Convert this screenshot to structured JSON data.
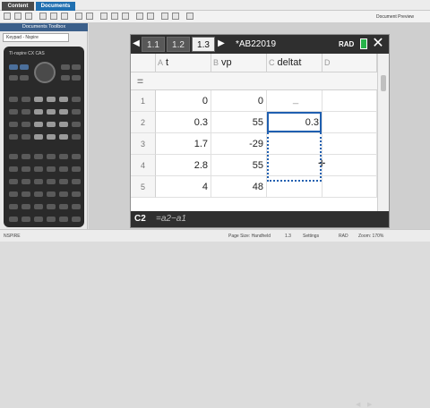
{
  "top_tabs": {
    "content": "Content",
    "documents": "Documents"
  },
  "toolbar": {
    "doc_preview": "Document Preview"
  },
  "left_panel": {
    "header": "Documents Toolbox",
    "keypad_select": "Keypad - Nspire",
    "calc_brand": "TI-nspire CX CAS"
  },
  "doc": {
    "tabs": [
      "1.1",
      "1.2",
      "1.3"
    ],
    "active_tab_index": 2,
    "title": "*AB22019",
    "mode": "RAD",
    "close": "✕",
    "prev_arrow": "◀",
    "next_arrow": "▶"
  },
  "sheet": {
    "columns": [
      {
        "letter": "A",
        "name": "t"
      },
      {
        "letter": "B",
        "name": "vp"
      },
      {
        "letter": "C",
        "name": "deltat"
      },
      {
        "letter": "D",
        "name": ""
      }
    ],
    "formula_row_symbol": "=",
    "rows": [
      {
        "num": "1",
        "t": "0",
        "vp": "0",
        "deltat": ""
      },
      {
        "num": "2",
        "t": "0.3",
        "vp": "55",
        "deltat": "0.3"
      },
      {
        "num": "3",
        "t": "1.7",
        "vp": "-29",
        "deltat": ""
      },
      {
        "num": "4",
        "t": "2.8",
        "vp": "55",
        "deltat": ""
      },
      {
        "num": "5",
        "t": "4",
        "vp": "48",
        "deltat": ""
      }
    ],
    "row1_tail": "_"
  },
  "entry_line": {
    "cell_ref": "C2",
    "formula": "=a2−a1"
  },
  "status": {
    "left": "NSPIRE",
    "page_size": "Page Size: Handheld",
    "zoom_label": "1.3",
    "settings": "Settings",
    "rad": "RAD",
    "zoom": "Zoom: 170%"
  },
  "colors": {
    "accent": "#1f5fb0",
    "dark_bar": "#2f2f2f",
    "battery": "#28b34a"
  }
}
